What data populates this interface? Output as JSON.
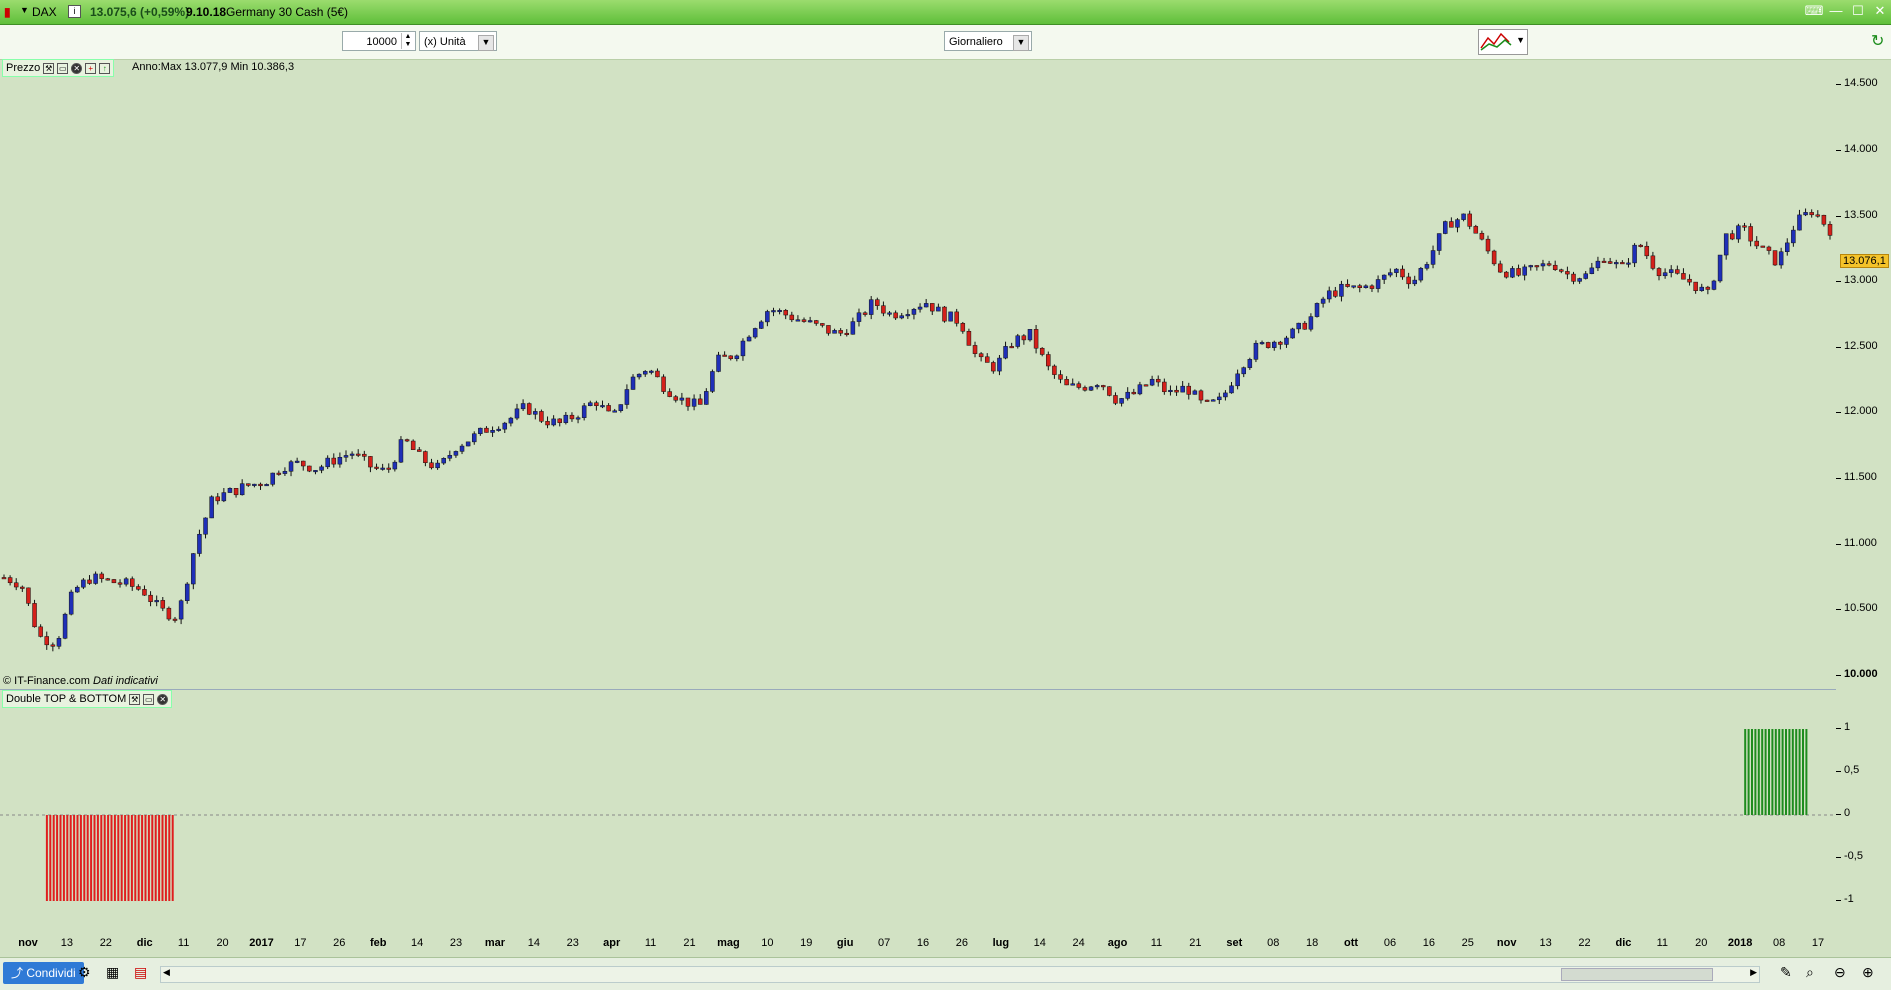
{
  "title": {
    "instrument": "DAX",
    "price": "13.075,6 (+0,59%)",
    "time": "9.10.18",
    "name": "Germany 30 Cash (5€)"
  },
  "toolbar": {
    "quantity": "10000",
    "unit": "(x) Unità",
    "timeframe": "Giornaliero"
  },
  "price_panel": {
    "label": "Prezzo",
    "info": "Anno:Max 13.077,9 Min 10.386,3",
    "copyright": "© IT-Finance.com",
    "disclaimer": "Dati indicativi",
    "current_price": "13.076,1"
  },
  "indicator_panel": {
    "label": "Double TOP & BOTTOM"
  },
  "y_axis": [
    "14.500",
    "14.000",
    "13.500",
    "13.000",
    "12.500",
    "12.000",
    "11.500",
    "11.000",
    "10.500",
    "10.000"
  ],
  "ind_axis": [
    "1",
    "0,5",
    "0",
    "-0,5",
    "-1"
  ],
  "x_labels": [
    "nov",
    "13",
    "22",
    "dic",
    "11",
    "20",
    "2017",
    "17",
    "26",
    "feb",
    "14",
    "23",
    "mar",
    "14",
    "23",
    "apr",
    "11",
    "21",
    "mag",
    "10",
    "19",
    "giu",
    "07",
    "16",
    "26",
    "lug",
    "14",
    "24",
    "ago",
    "11",
    "21",
    "set",
    "08",
    "18",
    "ott",
    "06",
    "16",
    "25",
    "nov",
    "13",
    "22",
    "dic",
    "11",
    "20",
    "2018",
    "08",
    "17"
  ],
  "x_bold": [
    "nov",
    "dic",
    "2017",
    "feb",
    "mar",
    "apr",
    "mag",
    "giu",
    "lug",
    "ago",
    "set",
    "ott",
    "2018"
  ],
  "status": {
    "share": "Condividi"
  },
  "colors": {
    "up": "#1f2fb8",
    "down": "#d4201a",
    "bull_signal": "#1e8c1e",
    "bear_signal": "#e01e1e",
    "background": "#d2e2c4"
  },
  "chart_data": {
    "type": "candlestick",
    "ylim": [
      9900,
      14700
    ],
    "price_path": [
      10750,
      10700,
      10300,
      10250,
      10650,
      10750,
      10720,
      10700,
      10650,
      10500,
      10450,
      11000,
      11350,
      11400,
      11450,
      11480,
      11600,
      11620,
      11580,
      11650,
      11700,
      11600,
      11550,
      11800,
      11650,
      11580,
      11750,
      11820,
      11900,
      11950,
      12050,
      11950,
      11920,
      12000,
      12100,
      11950,
      12250,
      12350,
      12200,
      12100,
      12050,
      12400,
      12450,
      12650,
      12800,
      12750,
      12700,
      12650,
      12600,
      12700,
      12850,
      12750,
      12800,
      12850,
      12750,
      12700,
      12400,
      12350,
      12550,
      12600,
      12350,
      12200,
      12200,
      12250,
      12100,
      12150,
      12250,
      12150,
      12200,
      12050,
      12100,
      12350,
      12500,
      12550,
      12600,
      12700,
      12900,
      12950,
      12950,
      13000,
      13100,
      13000,
      13200,
      13450,
      13500,
      13300,
      13100,
      13050,
      13100,
      13150,
      13050,
      13050,
      13200,
      13100,
      13300,
      13100,
      13050,
      13000,
      12900,
      13350,
      13400,
      13250,
      13150,
      13450,
      13550,
      13400
    ],
    "indicator": {
      "bear_signal_range_x": [
        0.025,
        0.094
      ],
      "bull_signal_range_x": [
        0.95,
        0.985
      ],
      "values": [
        -1,
        1
      ]
    }
  }
}
